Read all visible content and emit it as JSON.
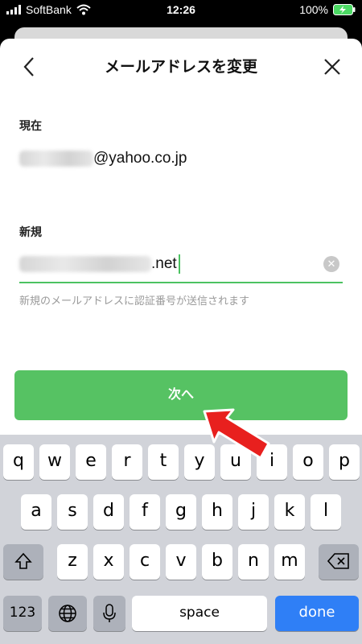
{
  "status_bar": {
    "carrier": "SoftBank",
    "time": "12:26",
    "battery": "100%"
  },
  "nav": {
    "title": "メールアドレスを変更",
    "back_icon": "chevron-left-icon",
    "close_icon": "close-icon"
  },
  "current": {
    "label": "現在",
    "value_suffix": "@yahoo.co.jp"
  },
  "new": {
    "label": "新規",
    "value_suffix": ".net",
    "hint": "新規のメールアドレスに認証番号が送信されます"
  },
  "next_button": {
    "label": "次へ"
  },
  "keyboard": {
    "row1": [
      "q",
      "w",
      "e",
      "r",
      "t",
      "y",
      "u",
      "i",
      "o",
      "p"
    ],
    "row2": [
      "a",
      "s",
      "d",
      "f",
      "g",
      "h",
      "j",
      "k",
      "l"
    ],
    "row3": [
      "z",
      "x",
      "c",
      "v",
      "b",
      "n",
      "m"
    ],
    "numbers_label": "123",
    "space_label": "space",
    "done_label": "done"
  },
  "colors": {
    "accent": "#56c263",
    "done": "#2f7ff6",
    "arrow": "#e8201e"
  }
}
